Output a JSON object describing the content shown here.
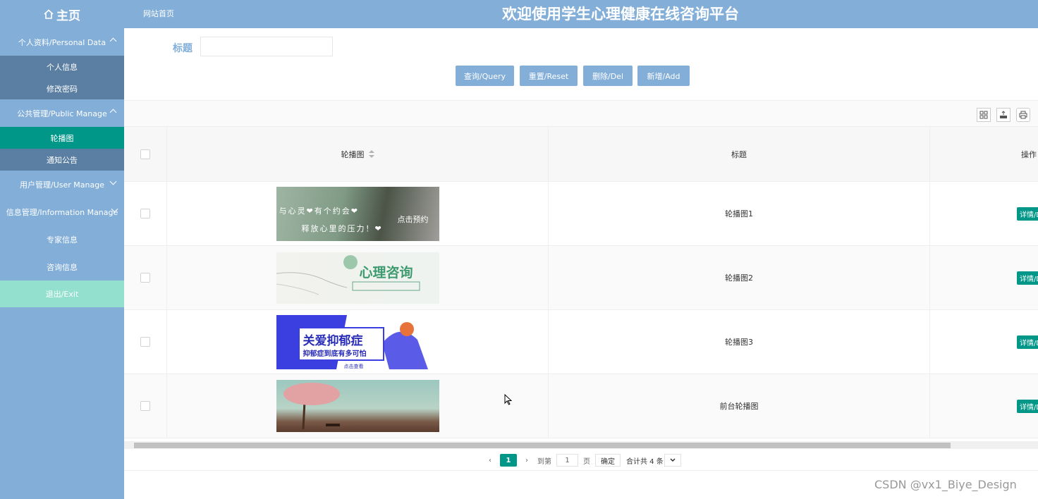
{
  "header": {
    "home_label": "主页",
    "site_link": "网站首页",
    "title": "欢迎使用学生心理健康在线咨询平台"
  },
  "sidebar": {
    "groups": [
      {
        "label": "个人资料/Personal Data",
        "items": [
          "个人信息",
          "修改密码"
        ]
      },
      {
        "label": "公共管理/Public Manage",
        "items": [
          "轮播图",
          "通知公告"
        ]
      }
    ],
    "user_manage": "用户管理/User Manage",
    "info_manage": "信息管理/Information Manage",
    "expert_info": "专家信息",
    "consult_info": "咨询信息",
    "exit": "退出/Exit",
    "active_item": "轮播图"
  },
  "search": {
    "label": "标题",
    "value": "",
    "buttons": {
      "query": "查询/Query",
      "reset": "重置/Reset",
      "delete": "删除/Del",
      "add": "新增/Add"
    }
  },
  "table": {
    "columns": [
      "轮播图",
      "标题",
      "操作"
    ],
    "rows": [
      {
        "title": "轮播图1",
        "action": "详情/Del",
        "banner_text": [
          "与心灵❤有个约会❤",
          "释放心里的压力！❤",
          "点击预约"
        ]
      },
      {
        "title": "轮播图2",
        "action": "详情/Del",
        "banner_text": [
          "心理咨询"
        ]
      },
      {
        "title": "轮播图3",
        "action": "详情/Del",
        "banner_text": [
          "关爱抑郁症",
          "抑郁症到底有多可怕",
          "点击查看"
        ]
      },
      {
        "title": "前台轮播图",
        "action": "详情/Del",
        "banner_text": []
      }
    ]
  },
  "pager": {
    "current_page": "1",
    "goto_label": "到第",
    "goto_value": "1",
    "page_unit": "页",
    "confirm": "确定",
    "total": "合计共 4 条"
  },
  "watermark": "CSDN @vx1_Biye_Design",
  "colors": {
    "header": "#82aed8",
    "active": "#009688",
    "submenu": "#5b7fa3",
    "exit": "#93e0cf"
  }
}
